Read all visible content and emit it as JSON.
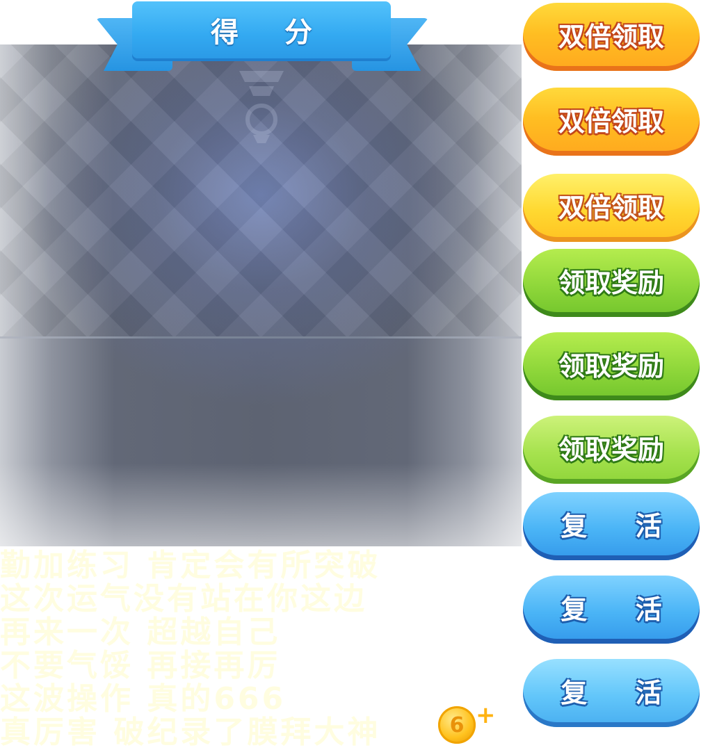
{
  "header": {
    "title": "得 分"
  },
  "buttons": {
    "double_claim": "双倍领取",
    "claim_reward": "领取奖励",
    "revive": "复 活"
  },
  "messages": [
    "勤加练习 肯定会有所突破",
    "这次运气没有站在你这边",
    "再来一次  超越自己",
    "不要气馁 再接再厉",
    "这波操作 真的666",
    "真厉害 破纪录了膜拜大神"
  ],
  "coin": {
    "glyph": "6",
    "plus": "+"
  },
  "colors": {
    "ribbon": "#33a9f1",
    "orange_button": "#ffbe22",
    "yellow_button": "#ffd830",
    "green_button": "#8fd73a",
    "blue_button": "#4ab4f6",
    "message_text": "#fffde0",
    "coin": "#ffc21e"
  },
  "icons": [
    "trophy-emblem-icon",
    "gold-coin-icon",
    "plus-icon"
  ]
}
